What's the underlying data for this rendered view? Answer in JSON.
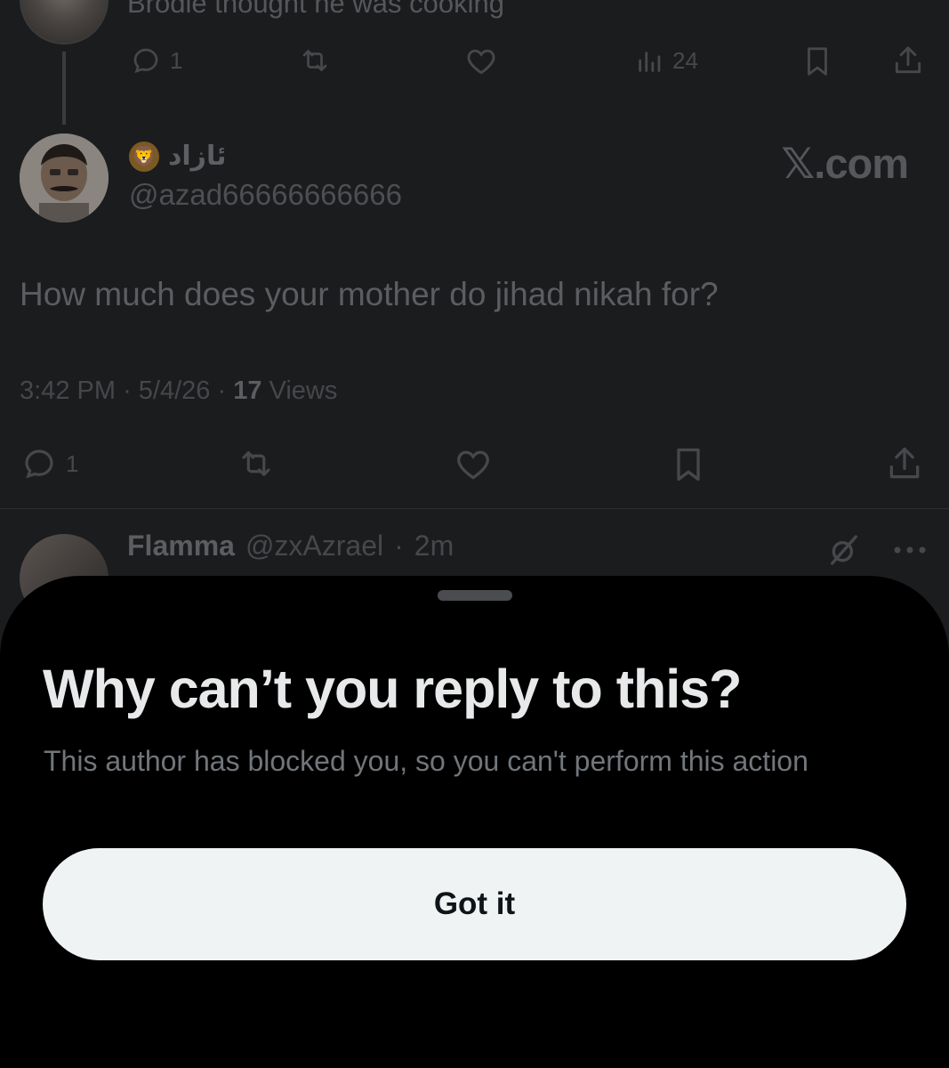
{
  "previous_tweet": {
    "text": "Brodie thought he was cooking",
    "reply_count": "1",
    "views_count": "24"
  },
  "tweet": {
    "display_name": "ئازاد",
    "name_emoji": "🦁",
    "handle": "@azad66666666666",
    "brand": "𝕏.com",
    "text": "How much does your mother do jihad nikah for?",
    "time": "3:42 PM",
    "date": "5/4/26",
    "views_number": "17",
    "views_label": "Views",
    "reply_count": "1"
  },
  "reply": {
    "name": "Flamma",
    "handle": "@zxAzrael",
    "age": "2m"
  },
  "sheet": {
    "title": "Why can’t you reply to this?",
    "subtitle": "This author has blocked you, so you can't perform this action",
    "button_label": "Got it"
  },
  "colors": {
    "sheet_bg": "#000000",
    "button_bg": "#eff3f4",
    "title_text": "#e7e9ea",
    "subtitle_text": "#71767b",
    "dimmed_bg": "#1b1c1e"
  }
}
